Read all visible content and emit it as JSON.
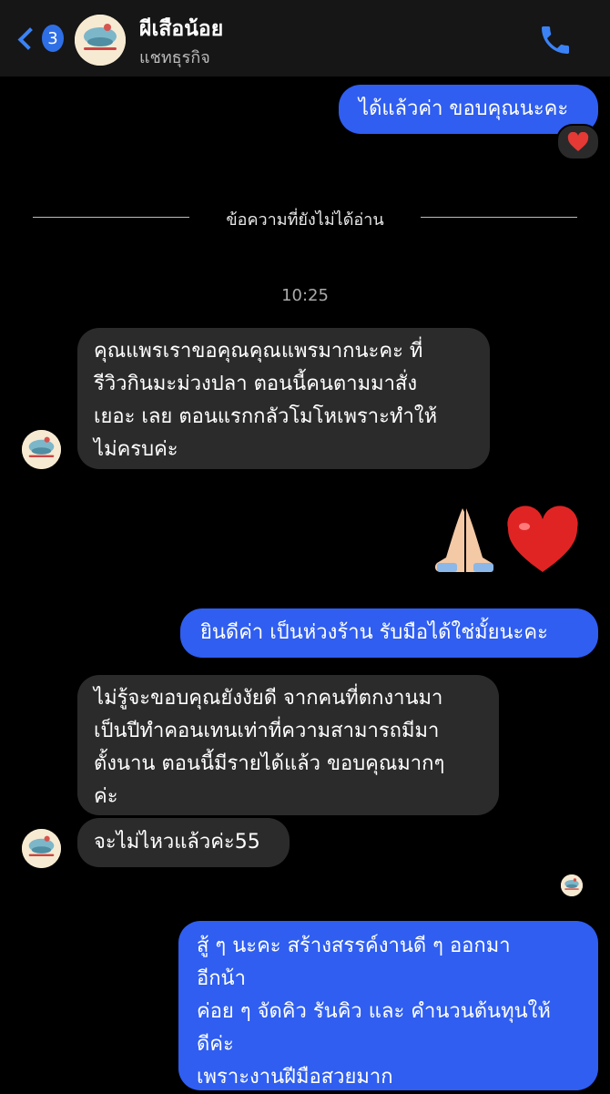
{
  "header": {
    "back_count": "3",
    "contact_name": "ผีเสือน้อย",
    "contact_type": "แชทธุรกิจ",
    "avatar_text": "ผีเสือน้อย"
  },
  "divider_label": "ข้อความที่ยังไม่ได้อ่าน",
  "timestamp": "10:25",
  "messages": {
    "m1": "ได้แล้วค่า ขอบคุณนะคะ",
    "m2": "คุณแพรเราขอคุณคุณแพรมากนะคะ ที่\nรีวิวกินมะม่วงปลา ตอนนี้คนตามมาสั่ง\nเยอะ เลย ตอนแรกกลัวโมโหเพราะทำให้\nไม่ครบค่ะ",
    "m3": "ยินดีค่า เป็นห่วงร้าน รับมือได้ใช่มั้ยนะคะ",
    "m4": "ไม่รู้จะขอบคุณยังงัยดี จากคนที่ตกงานมา\nเป็นปีทำคอนเทนเท่าที่ความสามารถมีมา\nตั้งนาน ตอนนี้มีรายได้แล้ว ขอบคุณมากๆ\nค่ะ",
    "m5": "จะไม่ไหวแล้วค่ะ55",
    "m6": "สู้ ๆ นะคะ สร้างสรรค์งานดี ๆ ออกมา\nอีกน้า\nค่อย ๆ จัดคิว รันคิว และ คำนวนต้นทุนให้\nดีค่ะ\nเพราะงานฝีมือสวยมาก"
  },
  "icons": {
    "back": "chevron-left-icon",
    "call": "phone-icon",
    "reaction": "heart-icon"
  },
  "colors": {
    "outgoing_bubble": "#2f5ef0",
    "incoming_bubble": "#2b2b2b",
    "accent": "#3b82f6"
  }
}
